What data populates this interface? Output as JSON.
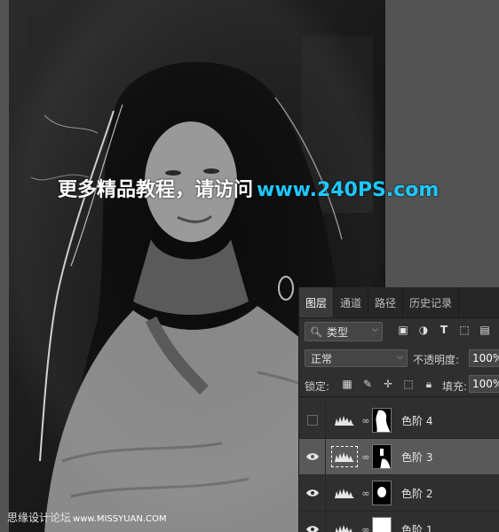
{
  "watermark": {
    "text": "更多精品教程，请访问",
    "url": "www.240PS.com"
  },
  "credit": {
    "text": "思缘设计论坛",
    "url": "www.MISSYUAN.COM"
  },
  "layers_panel": {
    "tabs": [
      {
        "label": "图层",
        "active": true
      },
      {
        "label": "通道",
        "active": false
      },
      {
        "label": "路径",
        "active": false
      },
      {
        "label": "历史记录",
        "active": false
      }
    ],
    "filter": {
      "label": "类型",
      "icons": [
        "image-filter-icon",
        "adjustment-filter-icon",
        "type-filter-icon",
        "shape-filter-icon",
        "smartobject-filter-icon"
      ]
    },
    "blend_mode": "正常",
    "opacity": {
      "label": "不透明度:",
      "value": "100%"
    },
    "lock": {
      "label": "锁定:",
      "icons": [
        "lock-transparent-icon",
        "lock-paint-icon",
        "lock-move-icon",
        "lock-artboard-icon",
        "lock-all-icon"
      ]
    },
    "fill": {
      "label": "填充:",
      "value": "100%"
    },
    "layers": [
      {
        "name": "色阶 4",
        "visible": false,
        "selected": false
      },
      {
        "name": "色阶 3",
        "visible": true,
        "selected": true
      },
      {
        "name": "色阶 2",
        "visible": true,
        "selected": false
      },
      {
        "name": "色阶 1",
        "visible": true,
        "selected": false
      }
    ]
  },
  "colors": {
    "accent_url": "#1ec8ff",
    "panel_bg": "#2f2f2f",
    "selected_layer": "#595959"
  }
}
